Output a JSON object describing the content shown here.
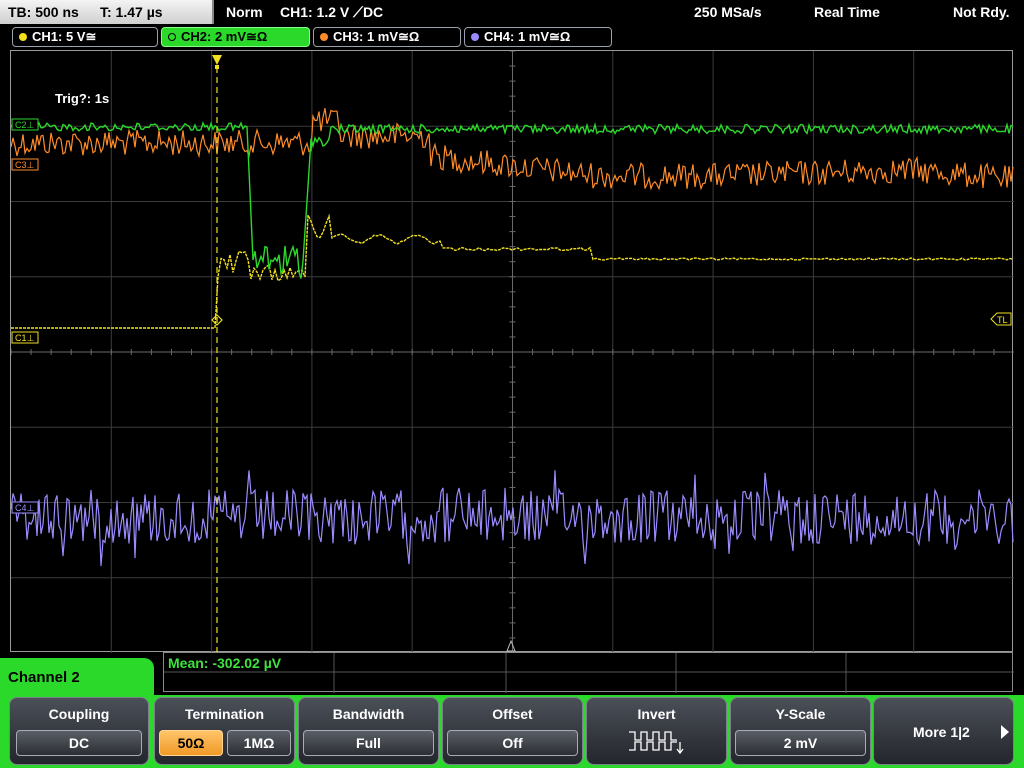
{
  "status": {
    "tb_label": "TB: 500 ns",
    "time_label": "T: 1.47 µs",
    "trigger_mode": "Norm",
    "trigger_info": "CH1: 1.2 V ⟋DC",
    "sample_rate": "250 MSa/s",
    "acq_mode": "Real Time",
    "state": "Not Rdy."
  },
  "channels": [
    {
      "label": "CH1: 5 V≅",
      "color": "#f0e020"
    },
    {
      "label": "CH2: 2 mV≅Ω",
      "color": "#2bd92b"
    },
    {
      "label": "CH3: 1 mV≅Ω",
      "color": "#ff8c2a"
    },
    {
      "label": "CH4: 1 mV≅Ω",
      "color": "#9a8cff"
    }
  ],
  "screen": {
    "trig_text": "Trig?: 1s",
    "markers": {
      "c1": "C1⊥",
      "c2": "C2⊥",
      "c3": "C3⊥",
      "c4": "C4⊥",
      "tl": "TL"
    }
  },
  "measurement": {
    "mean_text": "Mean: -302.02 µV"
  },
  "menu": {
    "channel_label": "Channel 2",
    "coupling": {
      "title": "Coupling",
      "value": "DC"
    },
    "termination": {
      "title": "Termination",
      "option_50": "50Ω",
      "option_1m": "1MΩ"
    },
    "bandwidth": {
      "title": "Bandwidth",
      "value": "Full"
    },
    "offset": {
      "title": "Offset",
      "value": "Off"
    },
    "invert": {
      "title": "Invert"
    },
    "yscale": {
      "title": "Y-Scale",
      "value": "2 mV"
    },
    "more": {
      "label": "More 1|2"
    }
  },
  "colors": {
    "ch1": "#f0e020",
    "ch2": "#2bd92b",
    "ch3": "#ff8c2a",
    "ch4": "#9a8cff",
    "grid": "#4a4a4a",
    "softkey_bg": "#2bd92b"
  }
}
